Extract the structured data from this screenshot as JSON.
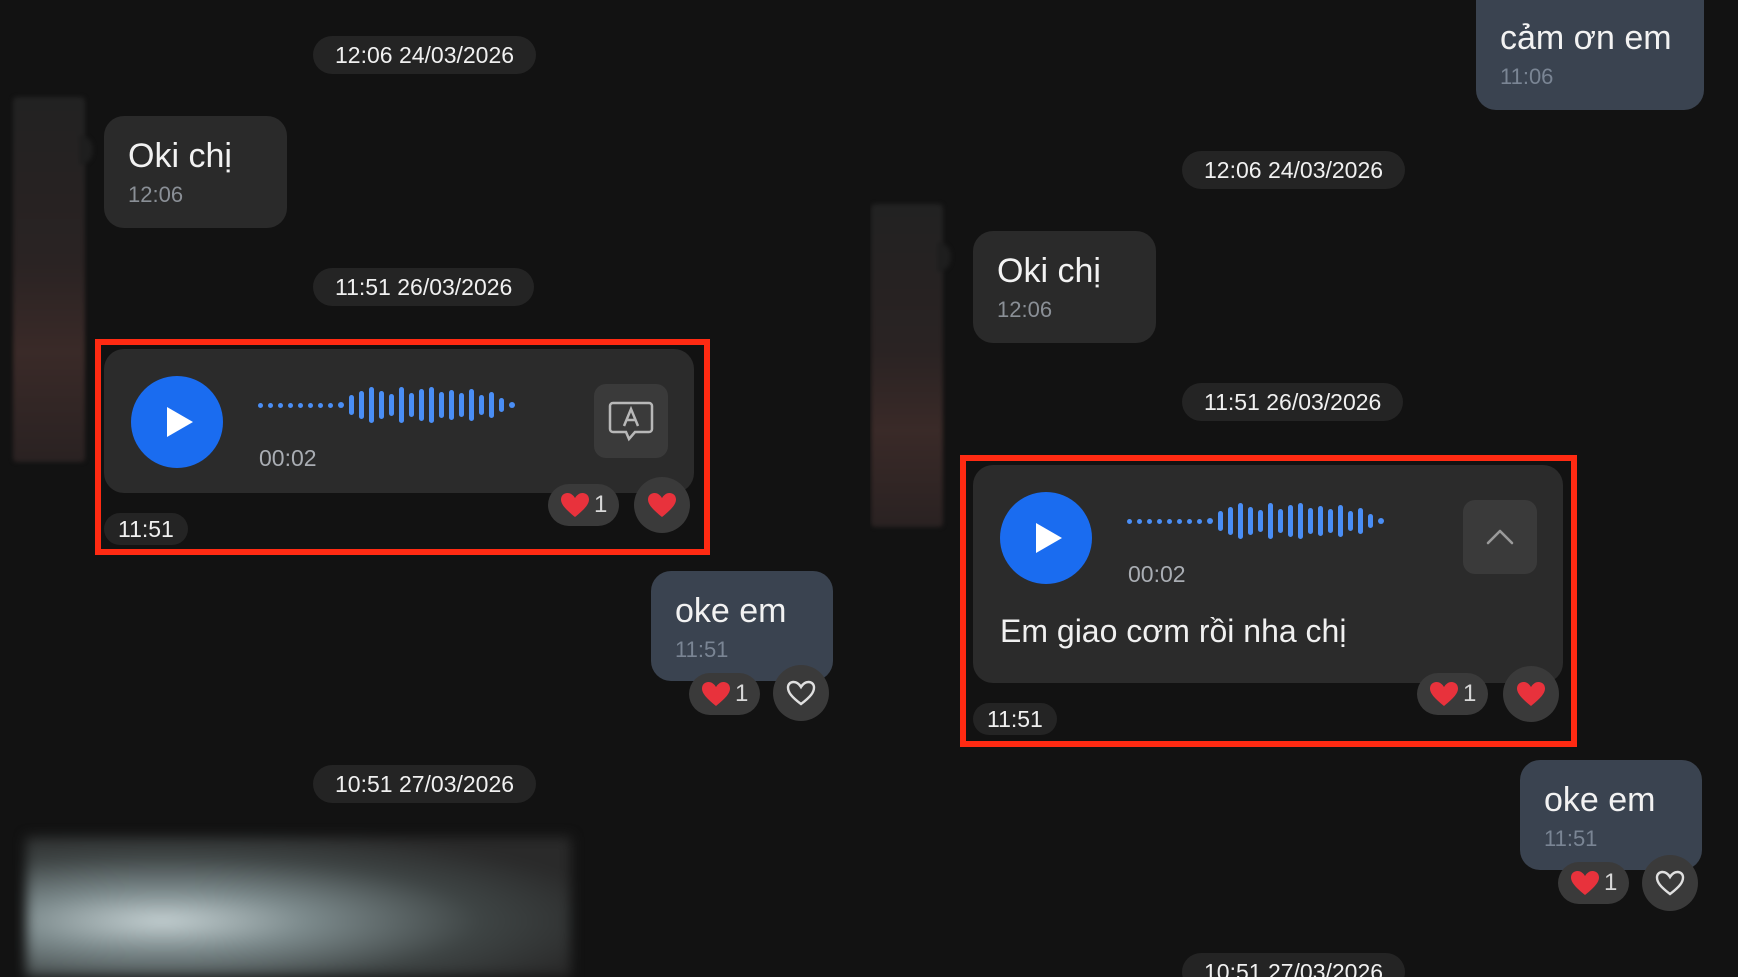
{
  "left": {
    "date_1": "12:06 24/03/2026",
    "msg_1": {
      "text": "Oki chị",
      "time": "12:06"
    },
    "date_2": "11:51 26/03/2026",
    "voice": {
      "duration": "00:02",
      "time": "11:51",
      "reaction_count": "1"
    },
    "msg_out": {
      "text": "oke em",
      "time": "11:51",
      "reaction_count": "1"
    },
    "date_3": "10:51 27/03/2026"
  },
  "right": {
    "msg_top_out": {
      "text": "cảm ơn em",
      "time": "11:06"
    },
    "date_1": "12:06 24/03/2026",
    "msg_1": {
      "text": "Oki chị",
      "time": "12:06"
    },
    "date_2": "11:51 26/03/2026",
    "voice": {
      "duration": "00:02",
      "transcript": "Em giao cơm rồi nha chị",
      "time": "11:51",
      "reaction_count": "1"
    },
    "msg_out": {
      "text": "oke em",
      "time": "11:51",
      "reaction_count": "1"
    },
    "date_3": "10:51 27/03/2026"
  },
  "colors": {
    "accent": "#1a6cf0",
    "highlight": "#ff2a12",
    "heart": "#e8323c"
  },
  "icons": [
    "play-icon",
    "speech-to-text-icon",
    "chevron-up-icon",
    "heart-icon",
    "heart-outline-icon"
  ]
}
